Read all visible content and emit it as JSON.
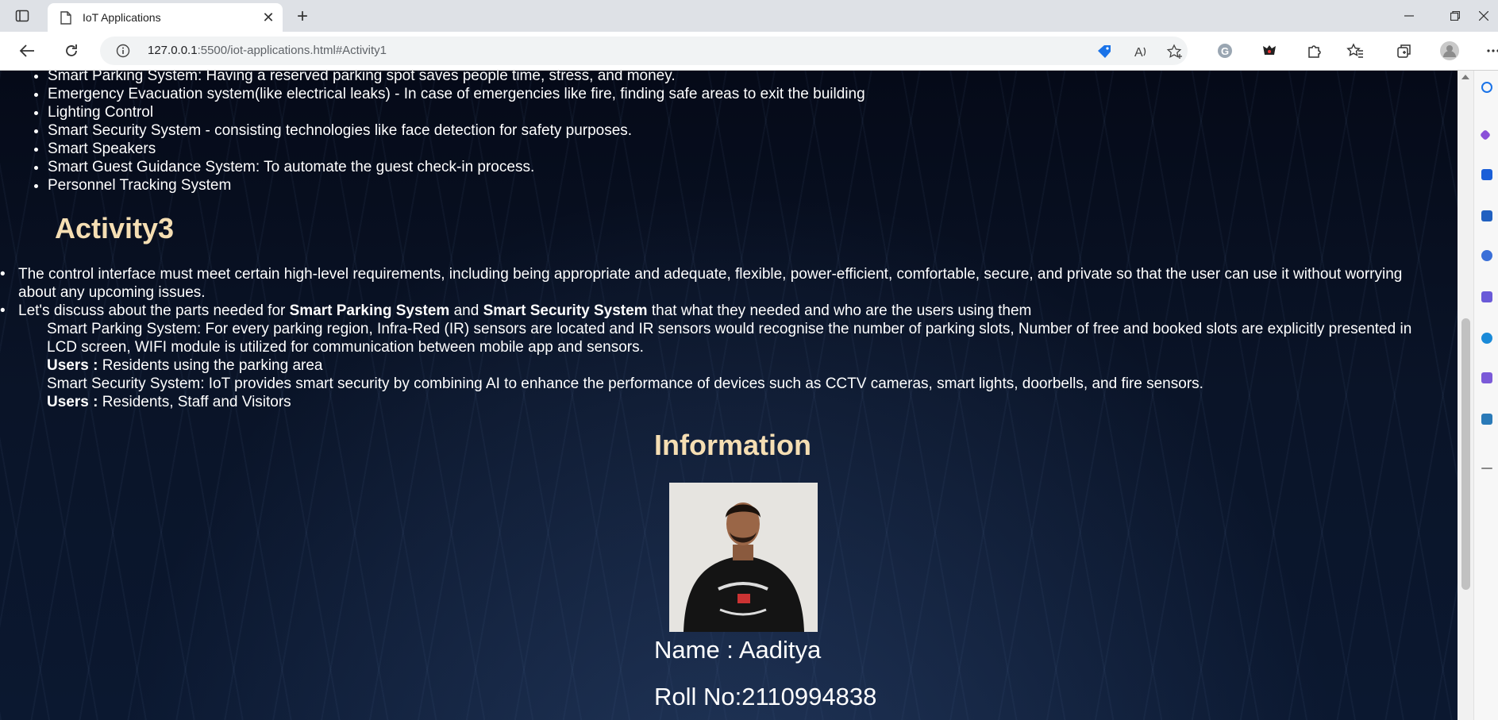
{
  "browser": {
    "tab_title": "IoT Applications",
    "url_host": "127.0.0.1",
    "url_rest": ":5500/iot-applications.html#Activity1"
  },
  "page": {
    "list1": [
      "Smart Parking System: Having a reserved parking spot saves people time, stress, and money.",
      "Emergency Evacuation system(like electrical leaks) - In case of emergencies like fire, finding safe areas to exit the building",
      "Lighting Control",
      "Smart Security System - consisting technologies like face detection for safety purposes.",
      "Smart Speakers",
      "Smart Guest Guidance System: To automate the guest check-in process.",
      "Personnel Tracking System"
    ],
    "activity3_heading": "Activity3",
    "para1": "The control interface must meet certain high-level requirements, including being appropriate and adequate, flexible, power-efficient, comfortable, secure, and private so that the user can use it without worrying about any upcoming issues.",
    "para2_a": "Let's discuss about the parts needed for ",
    "para2_b": "Smart Parking System",
    "para2_c": " and ",
    "para2_d": "Smart Security System",
    "para2_e": " that what they needed and who are the users using them",
    "parking_desc": "Smart Parking System: For every parking region, Infra-Red (IR) sensors are located and IR sensors would recognise the number of parking slots, Number of free and booked slots are explicitly presented in LCD screen, WIFI module is utilized for communication between mobile app and sensors.",
    "users_label": "Users :",
    "parking_users": " Residents using the parking area",
    "security_desc": "Smart Security System: IoT provides smart security by combining AI to enhance the performance of devices such as CCTV cameras, smart lights, doorbells, and fire sensors.",
    "security_users": " Residents, Staff and Visitors",
    "info_heading": "Information",
    "name_line": "Name : Aaditya",
    "roll_line": "Roll No:2110994838"
  },
  "colors": {
    "heading": "#f5deb3",
    "text": "#ffffff"
  }
}
